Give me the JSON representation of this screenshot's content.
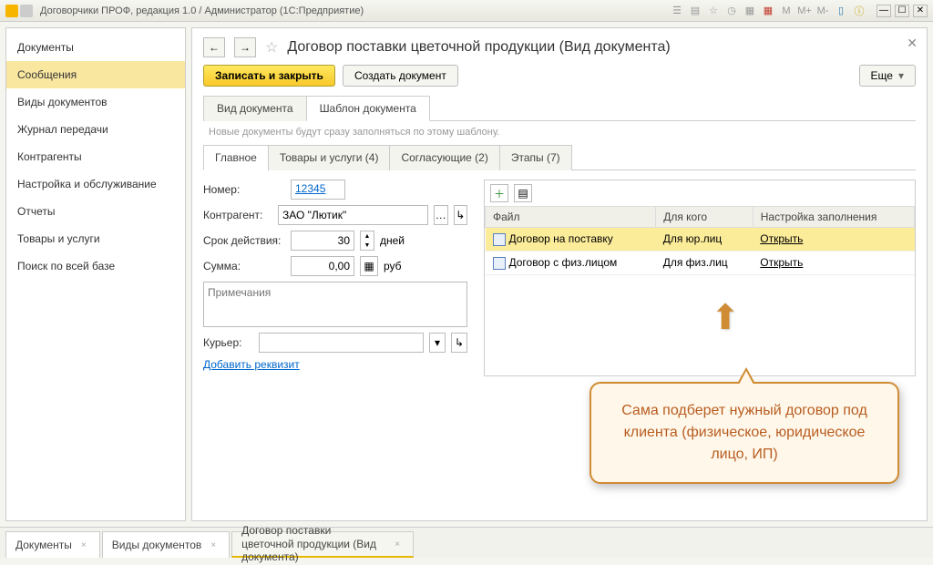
{
  "window_title": "Договорчики ПРОФ, редакция 1.0 / Администратор (1C:Предприятие)",
  "toolbar_letters": [
    "M",
    "M+",
    "M-"
  ],
  "sidebar": {
    "items": [
      "Документы",
      "Сообщения",
      "Виды документов",
      "Журнал передачи",
      "Контрагенты",
      "Настройка и обслуживание",
      "Отчеты",
      "Товары и услуги",
      "Поиск по всей базе"
    ],
    "active_index": 1
  },
  "doc": {
    "title": "Договор поставки цветочной продукции (Вид документа)",
    "save_close": "Записать и закрыть",
    "create": "Создать документ",
    "more": "Еще"
  },
  "tabs": {
    "items": [
      "Вид документа",
      "Шаблон документа"
    ],
    "active": 1
  },
  "hint": "Новые документы будут сразу заполняться по этому шаблону.",
  "subtabs": {
    "items": [
      "Главное",
      "Товары и услуги (4)",
      "Согласующие (2)",
      "Этапы (7)"
    ],
    "active": 0
  },
  "form": {
    "number_label": "Номер:",
    "number_value": "12345",
    "counterparty_label": "Контрагент:",
    "counterparty_value": "ЗАО \"Лютик\"",
    "term_label": "Срок действия:",
    "term_value": "30",
    "term_unit": "дней",
    "sum_label": "Сумма:",
    "sum_value": "0,00",
    "sum_currency": "руб",
    "notes_placeholder": "Примечания",
    "courier_label": "Курьер:",
    "courier_value": "",
    "add_field": "Добавить реквизит"
  },
  "grid": {
    "columns": [
      "Файл",
      "Для кого",
      "Настройка заполнения"
    ],
    "open_label": "Открыть",
    "rows": [
      {
        "file": "Договор на поставку",
        "for": "Для юр.лиц",
        "selected": true
      },
      {
        "file": "Договор с физ.лицом",
        "for": "Для физ.лиц",
        "selected": false
      }
    ]
  },
  "callout": "Сама подберет нужный договор под клиента (физическое, юридическое лицо, ИП)",
  "bottom_tabs": {
    "items": [
      "Документы",
      "Виды документов",
      "Договор поставки цветочной продукции (Вид документа)"
    ],
    "active": 2
  }
}
